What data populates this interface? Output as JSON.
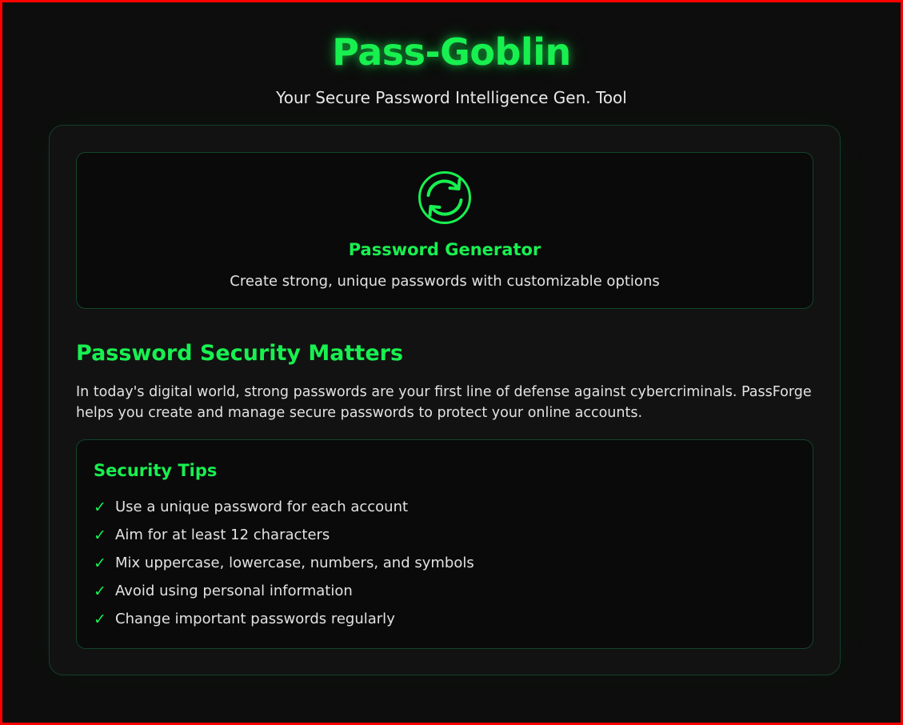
{
  "header": {
    "title": "Pass-Goblin",
    "subtitle": "Your Secure Password Intelligence Gen. Tool"
  },
  "generator": {
    "icon": "refresh-icon",
    "title": "Password Generator",
    "description": "Create strong, unique passwords with customizable options"
  },
  "security": {
    "heading": "Password Security Matters",
    "text": "In today's digital world, strong passwords are your first line of defense against cybercriminals. PassForge helps you create and manage secure passwords to protect your online accounts."
  },
  "tips": {
    "heading": "Security Tips",
    "check_glyph": "✓",
    "items": [
      "Use a unique password for each account",
      "Aim for at least 12 characters",
      "Mix uppercase, lowercase, numbers, and symbols",
      "Avoid using personal information",
      "Change important passwords regularly"
    ]
  },
  "colors": {
    "accent": "#18f050",
    "background": "#0d0d0d",
    "card": "#121212",
    "inner_card": "#0a0a0a",
    "frame": "#ff0000"
  }
}
